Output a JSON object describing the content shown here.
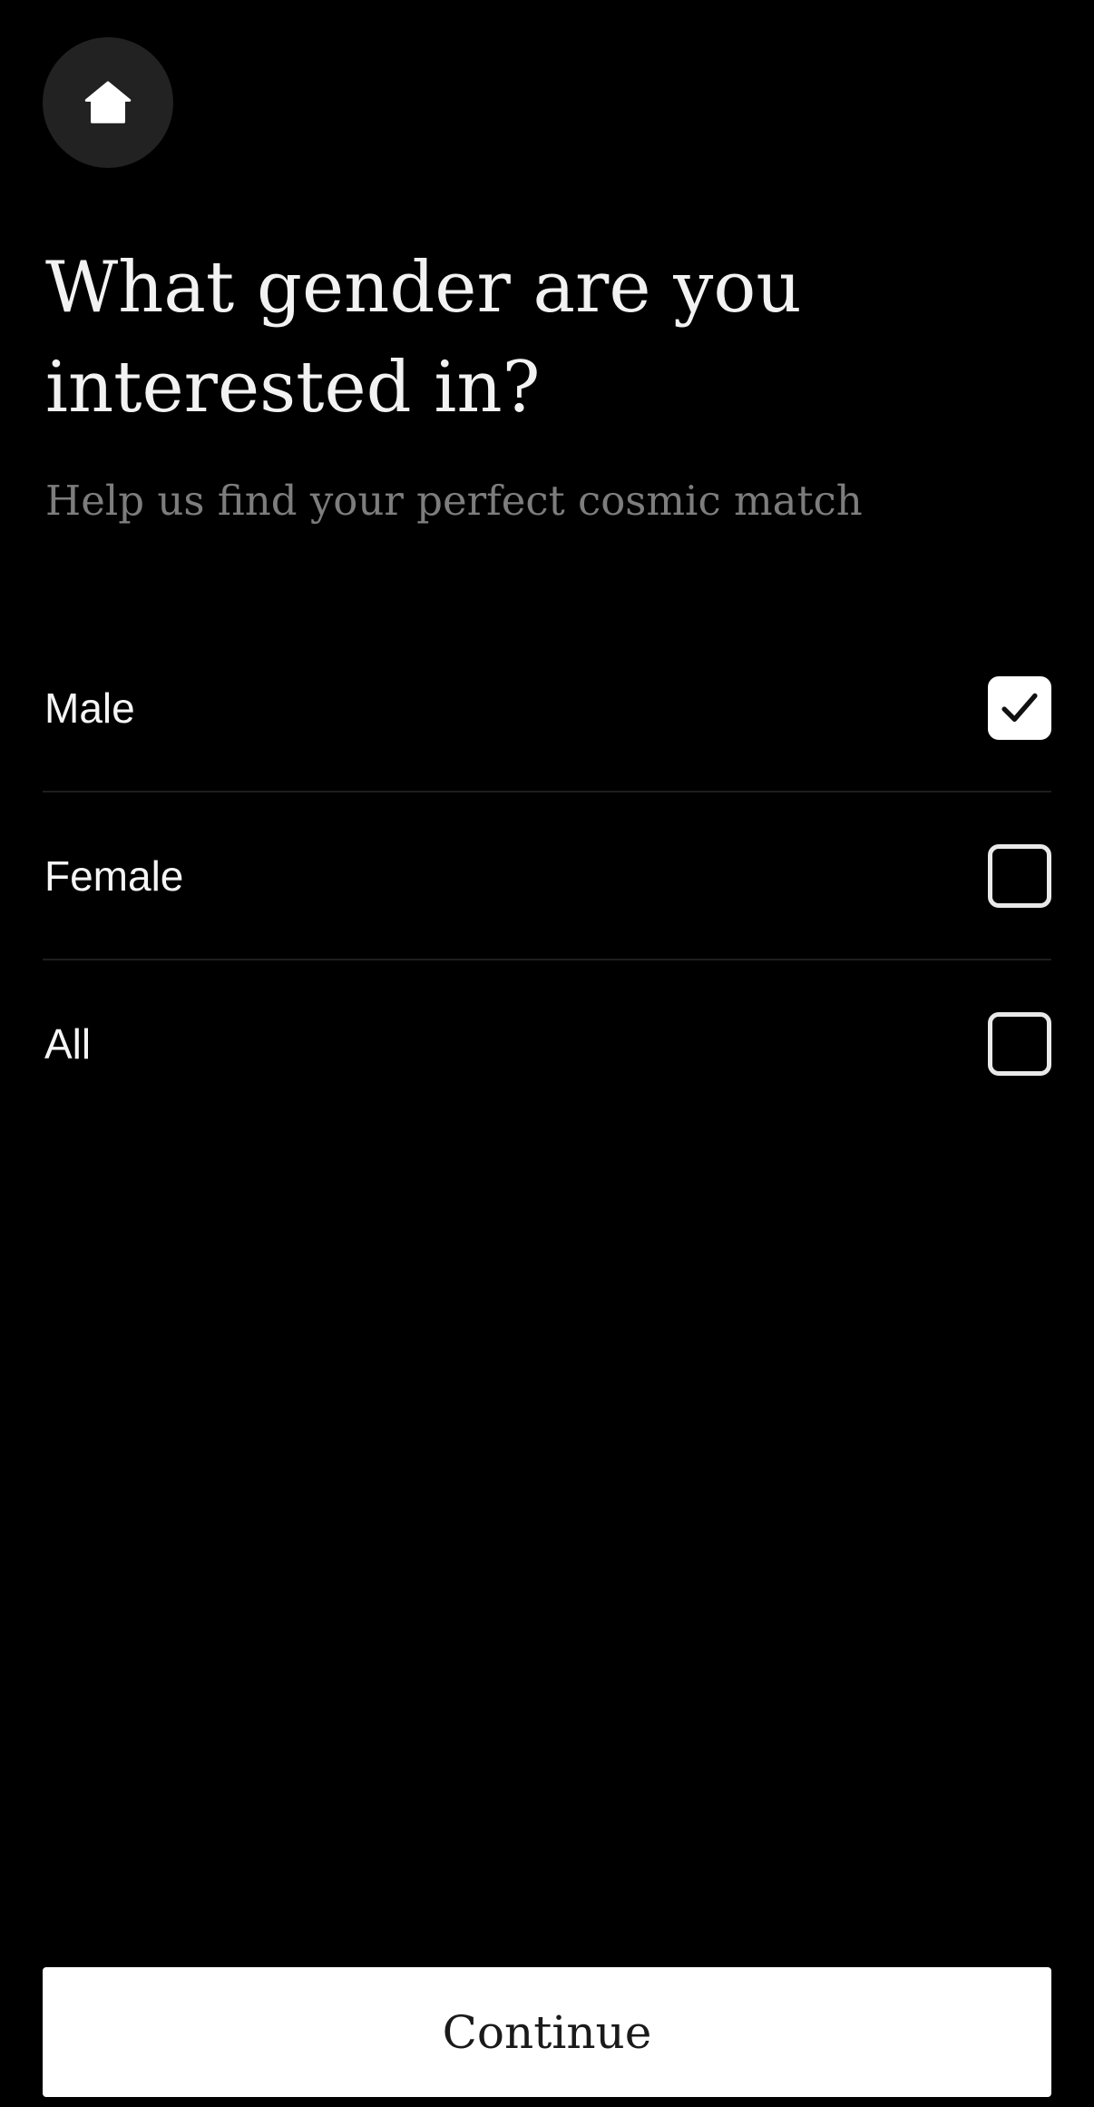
{
  "header": {
    "home_icon": "home-icon"
  },
  "question": {
    "title": "What gender are you interested in?",
    "subtitle": "Help us find your perfect cosmic match"
  },
  "options": [
    {
      "label": "Male",
      "checked": true
    },
    {
      "label": "Female",
      "checked": false
    },
    {
      "label": "All",
      "checked": false
    }
  ],
  "footer": {
    "continue_label": "Continue"
  },
  "colors": {
    "background": "#000000",
    "home_button_bg": "#222222",
    "subtitle": "#7d7d7d",
    "button_bg": "#ffffff"
  }
}
